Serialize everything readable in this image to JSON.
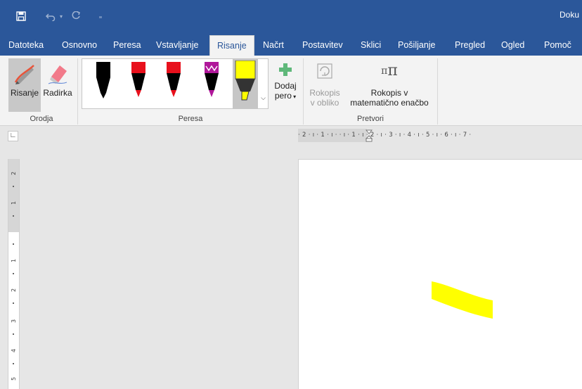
{
  "title_bar": {
    "document_title": "Doku"
  },
  "quick_access": [
    {
      "name": "save-icon"
    },
    {
      "name": "undo-icon"
    },
    {
      "name": "redo-icon"
    },
    {
      "name": "customize-icon"
    }
  ],
  "tabs": [
    {
      "label": "Datoteka"
    },
    {
      "label": "Osnovno"
    },
    {
      "label": "Peresa"
    },
    {
      "label": "Vstavljanje"
    },
    {
      "label": "Risanje",
      "active": true
    },
    {
      "label": "Načrt"
    },
    {
      "label": "Postavitev"
    },
    {
      "label": "Sklici"
    },
    {
      "label": "Pošiljanje"
    },
    {
      "label": "Pregled"
    },
    {
      "label": "Ogled"
    },
    {
      "label": "Pomoč"
    }
  ],
  "ribbon": {
    "tools_group": {
      "label": "Orodja",
      "draw_label": "Risanje",
      "eraser_label": "Radirka"
    },
    "pens_group": {
      "label": "Peresa",
      "add_pen_line1": "Dodaj",
      "add_pen_line2": "pero",
      "pens": [
        {
          "name": "black-pen",
          "color": "#000000"
        },
        {
          "name": "red-pen",
          "color": "#e8101c"
        },
        {
          "name": "red-pen-2",
          "color": "#e8101c"
        },
        {
          "name": "galaxy-pen",
          "color": "#b0179a"
        },
        {
          "name": "yellow-highlighter",
          "color": "#ffff00"
        }
      ]
    },
    "convert_group": {
      "label": "Pretvori",
      "ink_to_shape_line1": "Rokopis",
      "ink_to_shape_line2": "v obliko",
      "ink_to_math_line1": "Rokopis v",
      "ink_to_math_line2": "matematično enačbo"
    }
  },
  "ruler": {
    "horizontal_text": "· 2 · ı · 1 · ı ·   · ı · 1 · ı · 2 · ı · 3 · ı · 4 · ı · 5 · ı · 6 · ı · 7 ·",
    "vertical_numbers": [
      "2",
      "1",
      "1",
      "2",
      "3",
      "4",
      "5"
    ]
  },
  "colors": {
    "accent": "#2b579a",
    "highlighter": "#ffff00"
  }
}
